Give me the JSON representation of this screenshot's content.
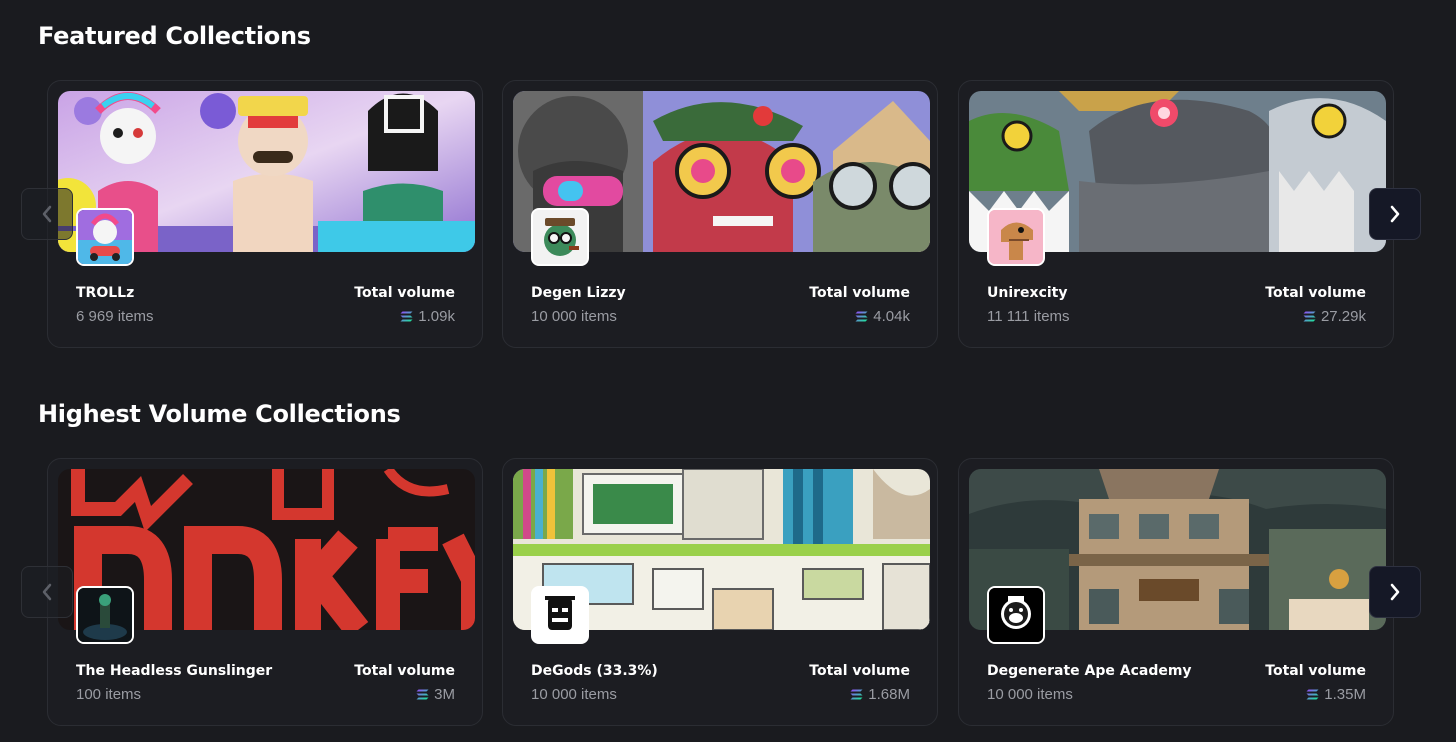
{
  "sections": [
    {
      "title": "Featured Collections",
      "cards": [
        {
          "name": "TROLLz",
          "items": "6 969 items",
          "volume_label": "Total volume",
          "volume": "1.09k"
        },
        {
          "name": "Degen Lizzy",
          "items": "10 000 items",
          "volume_label": "Total volume",
          "volume": "4.04k"
        },
        {
          "name": "Unirexcity",
          "items": "11 111 items",
          "volume_label": "Total volume",
          "volume": "27.29k"
        }
      ]
    },
    {
      "title": "Highest Volume Collections",
      "cards": [
        {
          "name": "The Headless Gunslinger",
          "items": "100 items",
          "volume_label": "Total volume",
          "volume": "3M"
        },
        {
          "name": "DeGods (33.3%)",
          "items": "10 000 items",
          "volume_label": "Total volume",
          "volume": "1.68M"
        },
        {
          "name": "Degenerate Ape Academy",
          "items": "10 000 items",
          "volume_label": "Total volume",
          "volume": "1.35M"
        }
      ]
    }
  ],
  "icons": {
    "currency": "solana-icon",
    "prev": "chevron-left-icon",
    "next": "chevron-right-icon"
  },
  "colors": {
    "background": "#1a1b1f",
    "card_border": "#2b2d33",
    "secondary_text": "#9a9ca3",
    "next_button": "#151826"
  }
}
